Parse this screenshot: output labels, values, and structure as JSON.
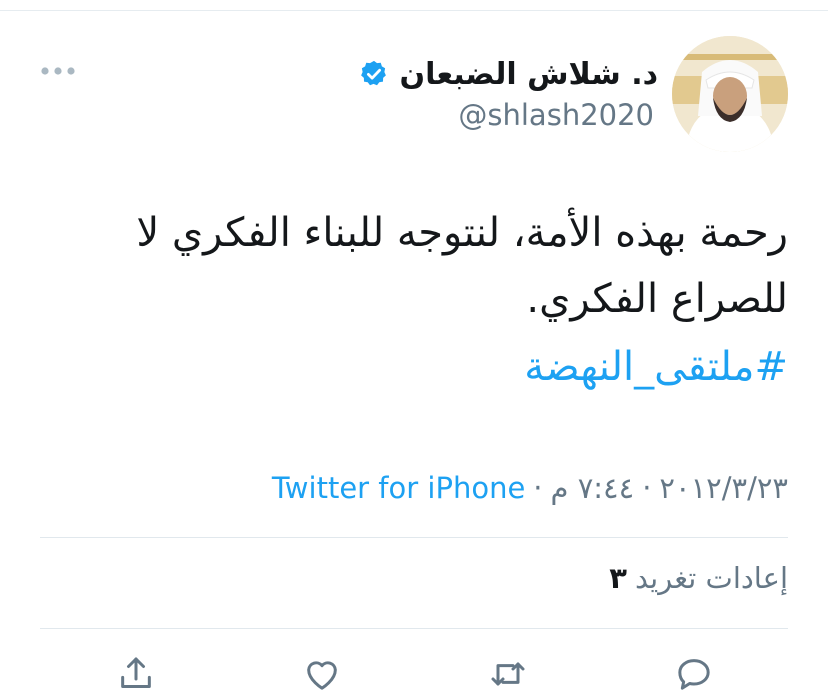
{
  "tweet": {
    "author": {
      "display_name": "د. شلاش الضبعان",
      "handle": "@shlash2020",
      "verified": true,
      "avatar_icon": "avatar-portrait"
    },
    "text": "رحمة بهذه الأمة، لنتوجه للبناء الفكري لا للصراع الفكري.",
    "hashtag": "#ملتقى_النهضة",
    "date": "٢٠١٢/٣/٢٣",
    "time": "٧:٤٤ م",
    "separator": "·",
    "source": "Twitter for iPhone",
    "retweets": {
      "count": "٣",
      "label": "إعادات تغريد"
    }
  },
  "actions": [
    {
      "icon": "reply-icon"
    },
    {
      "icon": "retweet-icon"
    },
    {
      "icon": "like-icon"
    },
    {
      "icon": "share-icon"
    }
  ],
  "colors": {
    "link": "#1da1f2",
    "muted": "#657786",
    "text": "#14171a",
    "divider": "#e1e8ed",
    "icon": "#657786"
  }
}
